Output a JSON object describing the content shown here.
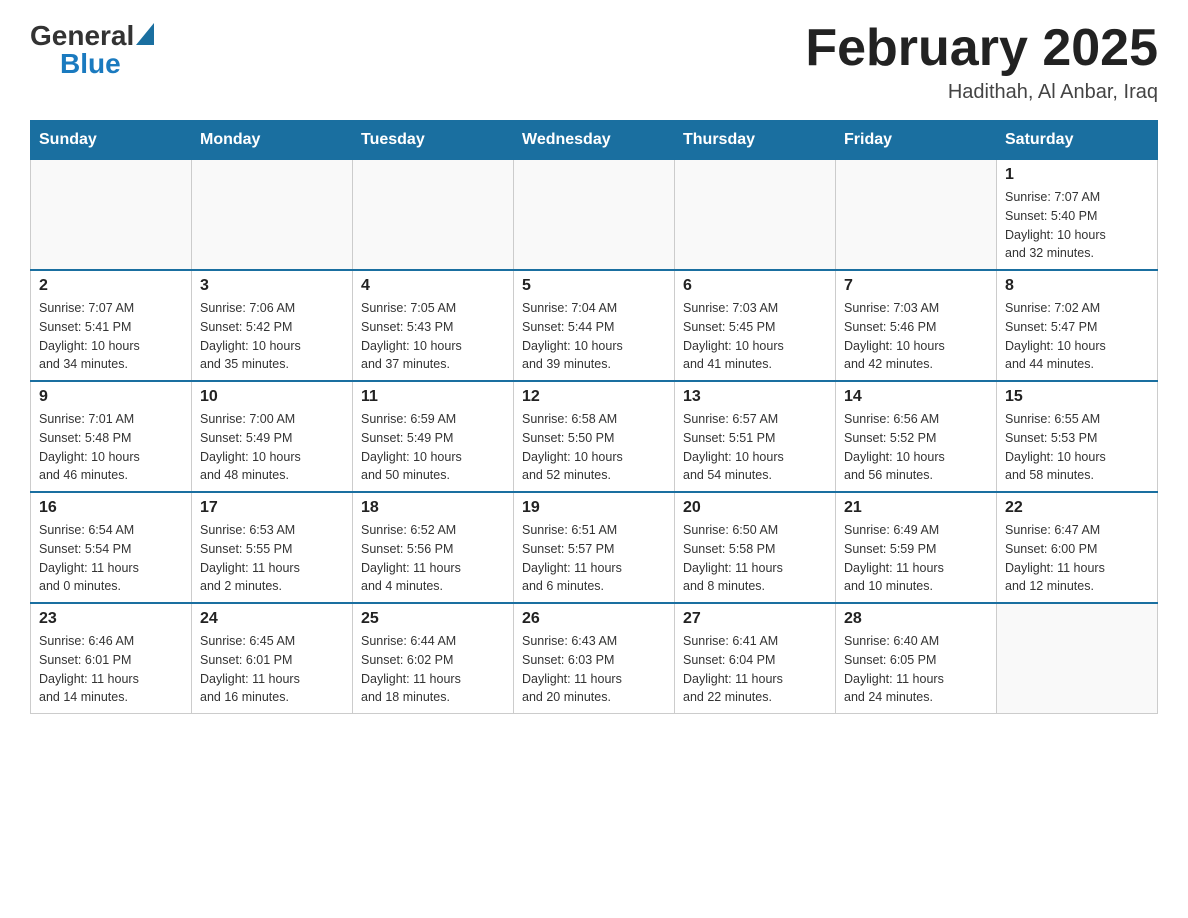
{
  "header": {
    "logo_general": "General",
    "logo_blue": "Blue",
    "title": "February 2025",
    "subtitle": "Hadithah, Al Anbar, Iraq"
  },
  "days_of_week": [
    "Sunday",
    "Monday",
    "Tuesday",
    "Wednesday",
    "Thursday",
    "Friday",
    "Saturday"
  ],
  "weeks": [
    [
      {
        "day": "",
        "info": ""
      },
      {
        "day": "",
        "info": ""
      },
      {
        "day": "",
        "info": ""
      },
      {
        "day": "",
        "info": ""
      },
      {
        "day": "",
        "info": ""
      },
      {
        "day": "",
        "info": ""
      },
      {
        "day": "1",
        "info": "Sunrise: 7:07 AM\nSunset: 5:40 PM\nDaylight: 10 hours\nand 32 minutes."
      }
    ],
    [
      {
        "day": "2",
        "info": "Sunrise: 7:07 AM\nSunset: 5:41 PM\nDaylight: 10 hours\nand 34 minutes."
      },
      {
        "day": "3",
        "info": "Sunrise: 7:06 AM\nSunset: 5:42 PM\nDaylight: 10 hours\nand 35 minutes."
      },
      {
        "day": "4",
        "info": "Sunrise: 7:05 AM\nSunset: 5:43 PM\nDaylight: 10 hours\nand 37 minutes."
      },
      {
        "day": "5",
        "info": "Sunrise: 7:04 AM\nSunset: 5:44 PM\nDaylight: 10 hours\nand 39 minutes."
      },
      {
        "day": "6",
        "info": "Sunrise: 7:03 AM\nSunset: 5:45 PM\nDaylight: 10 hours\nand 41 minutes."
      },
      {
        "day": "7",
        "info": "Sunrise: 7:03 AM\nSunset: 5:46 PM\nDaylight: 10 hours\nand 42 minutes."
      },
      {
        "day": "8",
        "info": "Sunrise: 7:02 AM\nSunset: 5:47 PM\nDaylight: 10 hours\nand 44 minutes."
      }
    ],
    [
      {
        "day": "9",
        "info": "Sunrise: 7:01 AM\nSunset: 5:48 PM\nDaylight: 10 hours\nand 46 minutes."
      },
      {
        "day": "10",
        "info": "Sunrise: 7:00 AM\nSunset: 5:49 PM\nDaylight: 10 hours\nand 48 minutes."
      },
      {
        "day": "11",
        "info": "Sunrise: 6:59 AM\nSunset: 5:49 PM\nDaylight: 10 hours\nand 50 minutes."
      },
      {
        "day": "12",
        "info": "Sunrise: 6:58 AM\nSunset: 5:50 PM\nDaylight: 10 hours\nand 52 minutes."
      },
      {
        "day": "13",
        "info": "Sunrise: 6:57 AM\nSunset: 5:51 PM\nDaylight: 10 hours\nand 54 minutes."
      },
      {
        "day": "14",
        "info": "Sunrise: 6:56 AM\nSunset: 5:52 PM\nDaylight: 10 hours\nand 56 minutes."
      },
      {
        "day": "15",
        "info": "Sunrise: 6:55 AM\nSunset: 5:53 PM\nDaylight: 10 hours\nand 58 minutes."
      }
    ],
    [
      {
        "day": "16",
        "info": "Sunrise: 6:54 AM\nSunset: 5:54 PM\nDaylight: 11 hours\nand 0 minutes."
      },
      {
        "day": "17",
        "info": "Sunrise: 6:53 AM\nSunset: 5:55 PM\nDaylight: 11 hours\nand 2 minutes."
      },
      {
        "day": "18",
        "info": "Sunrise: 6:52 AM\nSunset: 5:56 PM\nDaylight: 11 hours\nand 4 minutes."
      },
      {
        "day": "19",
        "info": "Sunrise: 6:51 AM\nSunset: 5:57 PM\nDaylight: 11 hours\nand 6 minutes."
      },
      {
        "day": "20",
        "info": "Sunrise: 6:50 AM\nSunset: 5:58 PM\nDaylight: 11 hours\nand 8 minutes."
      },
      {
        "day": "21",
        "info": "Sunrise: 6:49 AM\nSunset: 5:59 PM\nDaylight: 11 hours\nand 10 minutes."
      },
      {
        "day": "22",
        "info": "Sunrise: 6:47 AM\nSunset: 6:00 PM\nDaylight: 11 hours\nand 12 minutes."
      }
    ],
    [
      {
        "day": "23",
        "info": "Sunrise: 6:46 AM\nSunset: 6:01 PM\nDaylight: 11 hours\nand 14 minutes."
      },
      {
        "day": "24",
        "info": "Sunrise: 6:45 AM\nSunset: 6:01 PM\nDaylight: 11 hours\nand 16 minutes."
      },
      {
        "day": "25",
        "info": "Sunrise: 6:44 AM\nSunset: 6:02 PM\nDaylight: 11 hours\nand 18 minutes."
      },
      {
        "day": "26",
        "info": "Sunrise: 6:43 AM\nSunset: 6:03 PM\nDaylight: 11 hours\nand 20 minutes."
      },
      {
        "day": "27",
        "info": "Sunrise: 6:41 AM\nSunset: 6:04 PM\nDaylight: 11 hours\nand 22 minutes."
      },
      {
        "day": "28",
        "info": "Sunrise: 6:40 AM\nSunset: 6:05 PM\nDaylight: 11 hours\nand 24 minutes."
      },
      {
        "day": "",
        "info": ""
      }
    ]
  ]
}
